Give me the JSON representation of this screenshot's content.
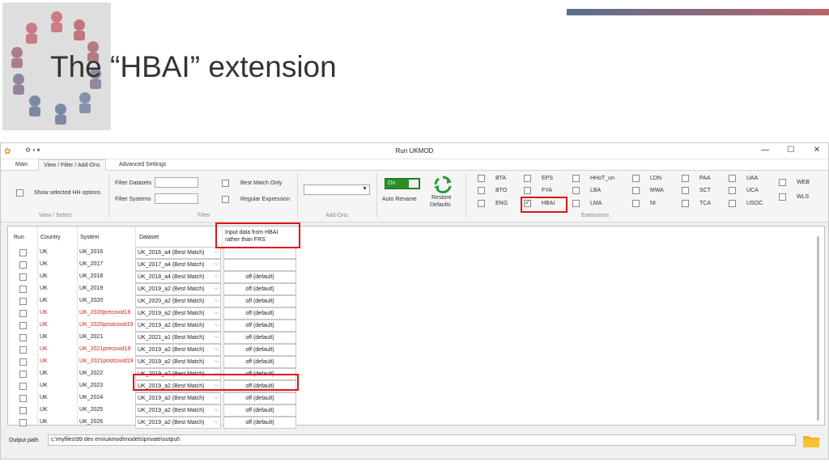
{
  "slide": {
    "title": "The “HBAI” extension"
  },
  "window": {
    "title": "Run UKMOD",
    "quick_access": "⚙ ▪ ▾",
    "minimize": "—",
    "maximize": "☐",
    "close": "✕"
  },
  "tabs": [
    "Main",
    "View / Filter / Add-Ons",
    "Advanced Settings"
  ],
  "ribbon": {
    "show_hh_options": "Show selected HH options",
    "view_select_group": "View / Select",
    "filter_datasets": "Filter Datasets",
    "filter_systems": "Filter Systems",
    "best_match_only": "Best Match Only",
    "regular_expression": "Regular Expression",
    "filter_group": "Filter",
    "addons_group": "Add-Ons",
    "toggle_label": "On",
    "auto_rename": "Auto Rename",
    "restore_defaults_1": "Restore",
    "restore_defaults_2": "Defaults",
    "extensions_group": "Extensions",
    "extensions": [
      {
        "label": "BTA",
        "checked": false
      },
      {
        "label": "BTO",
        "checked": false
      },
      {
        "label": "ENG",
        "checked": false
      },
      {
        "label": "EPS",
        "checked": false
      },
      {
        "label": "FYA",
        "checked": false
      },
      {
        "label": "HBAI",
        "checked": true
      },
      {
        "label": "HHoT_un",
        "checked": false
      },
      {
        "label": "LBA",
        "checked": false
      },
      {
        "label": "LMA",
        "checked": false
      },
      {
        "label": "LDN",
        "checked": false
      },
      {
        "label": "MWA",
        "checked": false
      },
      {
        "label": "NI",
        "checked": false
      },
      {
        "label": "PAA",
        "checked": false
      },
      {
        "label": "SCT",
        "checked": false
      },
      {
        "label": "TCA",
        "checked": false
      },
      {
        "label": "UAA",
        "checked": false
      },
      {
        "label": "UCA",
        "checked": false
      },
      {
        "label": "USOC",
        "checked": false
      },
      {
        "label": "WEB",
        "checked": false
      },
      {
        "label": "WLS",
        "checked": false
      }
    ]
  },
  "grid": {
    "headers": {
      "run": "Run",
      "country": "Country",
      "system": "System",
      "dataset": "Dataset",
      "hbai_1": "Input data from HBAI",
      "hbai_2": "rather than FRS"
    },
    "rows": [
      {
        "country": "UK",
        "system": "UK_2016",
        "dataset": "UK_2016_a4 (Best Match)",
        "hbai": "",
        "red": false
      },
      {
        "country": "UK",
        "system": "UK_2017",
        "dataset": "UK_2017_a4 (Best Match)",
        "hbai": "",
        "red": false
      },
      {
        "country": "UK",
        "system": "UK_2018",
        "dataset": "UK_2018_a4 (Best Match)",
        "hbai": "off (default)",
        "red": false
      },
      {
        "country": "UK",
        "system": "UK_2019",
        "dataset": "UK_2019_a2 (Best Match)",
        "hbai": "off (default)",
        "red": false
      },
      {
        "country": "UK",
        "system": "UK_2020",
        "dataset": "UK_2020_a2 (Best Match)",
        "hbai": "off (default)",
        "red": false
      },
      {
        "country": "UK",
        "system": "UK_2020precovid19",
        "dataset": "UK_2019_a2 (Best Match)",
        "hbai": "off (default)",
        "red": true
      },
      {
        "country": "UK",
        "system": "UK_2020postcovid19",
        "dataset": "UK_2019_a2 (Best Match)",
        "hbai": "off (default)",
        "red": true
      },
      {
        "country": "UK",
        "system": "UK_2021",
        "dataset": "UK_2021_a1 (Best Match)",
        "hbai": "off (default)",
        "red": false
      },
      {
        "country": "UK",
        "system": "UK_2021precovid19",
        "dataset": "UK_2019_a2 (Best Match)",
        "hbai": "off (default)",
        "red": true
      },
      {
        "country": "UK",
        "system": "UK_2021postcovid19",
        "dataset": "UK_2019_a2 (Best Match)",
        "hbai": "off (default)",
        "red": true
      },
      {
        "country": "UK",
        "system": "UK_2022",
        "dataset": "UK_2019_a2 (Best Match)",
        "hbai": "off (default)",
        "red": false
      },
      {
        "country": "UK",
        "system": "UK_2023",
        "dataset": "UK_2019_a2 (Best Match)",
        "hbai": "off (default)",
        "red": false
      },
      {
        "country": "UK",
        "system": "UK_2024",
        "dataset": "UK_2019_a2 (Best Match)",
        "hbai": "off (default)",
        "red": false
      },
      {
        "country": "UK",
        "system": "UK_2025",
        "dataset": "UK_2019_a2 (Best Match)",
        "hbai": "off (default)",
        "red": false
      },
      {
        "country": "UK",
        "system": "UK_2026",
        "dataset": "UK_2019_a2 (Best Match)",
        "hbai": "off (default)",
        "red": false
      }
    ]
  },
  "output": {
    "label": "Output path",
    "path": "c:\\myfiles\\99 dev env\\ukmod\\models\\private\\output\\"
  },
  "colors": {
    "highlight": "#e01515",
    "red_text": "#d61d1d",
    "toggle_on": "#2a8f2a",
    "restore_icon": "#2a9a3a",
    "folder": "#f2b11a"
  }
}
